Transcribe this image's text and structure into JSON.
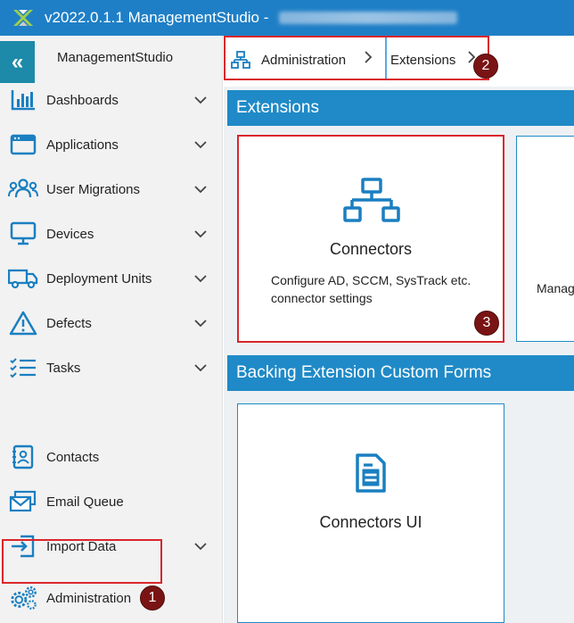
{
  "window": {
    "title": "v2022.0.1.1 ManagementStudio -"
  },
  "sidebar": {
    "app_name": "ManagementStudio",
    "collapse_glyph": "«",
    "items": [
      {
        "label": "Dashboards",
        "icon": "dashboard-bar-chart-icon",
        "has_chevron": true
      },
      {
        "label": "Applications",
        "icon": "application-window-icon",
        "has_chevron": true
      },
      {
        "label": "User Migrations",
        "icon": "user-group-icon",
        "has_chevron": true
      },
      {
        "label": "Devices",
        "icon": "monitor-icon",
        "has_chevron": true
      },
      {
        "label": "Deployment Units",
        "icon": "truck-icon",
        "has_chevron": true
      },
      {
        "label": "Defects",
        "icon": "warning-triangle-icon",
        "has_chevron": true
      },
      {
        "label": "Tasks",
        "icon": "checklist-icon",
        "has_chevron": true
      },
      {
        "label": "Contacts",
        "icon": "contact-card-icon",
        "has_chevron": false
      },
      {
        "label": "Email Queue",
        "icon": "email-icon",
        "has_chevron": false
      },
      {
        "label": "Import Data",
        "icon": "import-icon",
        "has_chevron": true
      },
      {
        "label": "Administration",
        "icon": "gears-icon",
        "has_chevron": false
      }
    ]
  },
  "breadcrumb": {
    "items": [
      {
        "label": "Administration",
        "icon": "sitemap-icon"
      },
      {
        "label": "Extensions"
      }
    ]
  },
  "sections": [
    {
      "title": "Extensions",
      "tiles": [
        {
          "title": "Connectors",
          "description_line1": "Configure AD, SCCM, SysTrack etc.",
          "description_line2": "connector settings",
          "icon": "network-hierarchy-icon"
        },
        {
          "partial_label": "Manag"
        }
      ]
    },
    {
      "title": "Backing Extension Custom Forms",
      "tiles": [
        {
          "title": "Connectors UI",
          "icon": "document-form-icon"
        }
      ]
    }
  ],
  "badges": {
    "one": "1",
    "two": "2",
    "three": "3"
  },
  "colors": {
    "title_bar": "#1f7fc6",
    "accent": "#1f8ac7",
    "icon_blue": "#1a7fc1",
    "highlight_red": "#d9262c",
    "badge_fill": "#7a1414"
  }
}
